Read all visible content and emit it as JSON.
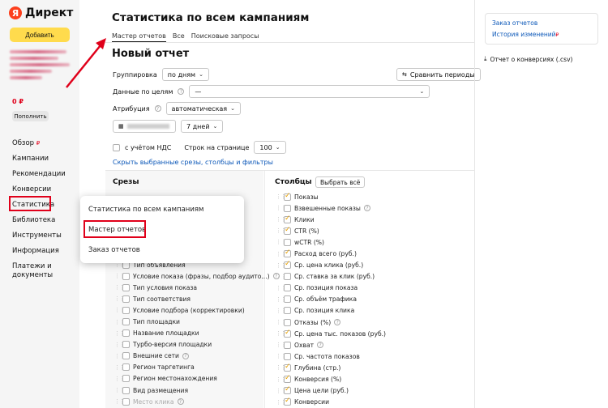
{
  "sidebar": {
    "logo_text": "Директ",
    "logo_mark": "Я",
    "add_label": "Добавить",
    "balance": "0 ₽",
    "refill_label": "Пополнить",
    "items": [
      {
        "label": "Обзор",
        "suffix": "₽"
      },
      {
        "label": "Кампании"
      },
      {
        "label": "Рекомендации"
      },
      {
        "label": "Конверсии"
      },
      {
        "label": "Статистика"
      },
      {
        "label": "Библиотека"
      },
      {
        "label": "Инструменты"
      },
      {
        "label": "Информация"
      },
      {
        "label": "Платежи и документы"
      }
    ]
  },
  "page": {
    "title": "Статистика по всем кампаниям",
    "tabs": [
      "Мастер отчетов",
      "Все",
      "Поисковые запросы"
    ],
    "report_title": "Новый отчет"
  },
  "form": {
    "grouping_label": "Группировка",
    "grouping_value": "по дням",
    "compare_label": "Сравнить периоды",
    "goals_label": "Данные по целям",
    "goals_value": "—",
    "attribution_label": "Атрибуция",
    "attribution_value": "автоматическая",
    "period_value": "7 дней",
    "vat_label": "с учётом НДС",
    "rows_label": "Строк на странице",
    "rows_value": "100",
    "hide_link": "Скрыть выбранные срезы, столбцы и фильтры"
  },
  "slices": {
    "title": "Срезы",
    "items": [
      {
        "label": "Тип объявления",
        "checked": false
      },
      {
        "label": "Условие показа (фразы, подбор аудито...)",
        "checked": false,
        "help": true
      },
      {
        "label": "Тип условия показа",
        "checked": false
      },
      {
        "label": "Тип соответствия",
        "checked": false
      },
      {
        "label": "Условие подбора (корректировки)",
        "checked": false
      },
      {
        "label": "Тип площадки",
        "checked": false
      },
      {
        "label": "Название площадки",
        "checked": false
      },
      {
        "label": "Турбо-версия площадки",
        "checked": false
      },
      {
        "label": "Внешние сети",
        "checked": false,
        "help": true
      },
      {
        "label": "Регион таргетинга",
        "checked": false
      },
      {
        "label": "Регион местонахождения",
        "checked": false
      },
      {
        "label": "Вид размещения",
        "checked": false
      },
      {
        "label": "Место клика",
        "checked": false,
        "help": true,
        "dim": true
      }
    ]
  },
  "columns": {
    "title": "Столбцы",
    "select_all_label": "Выбрать всё",
    "items": [
      {
        "label": "Показы",
        "checked": true
      },
      {
        "label": "Взвешенные показы",
        "checked": false,
        "help": true
      },
      {
        "label": "Клики",
        "checked": true
      },
      {
        "label": "CTR (%)",
        "checked": true
      },
      {
        "label": "wCTR (%)",
        "checked": false
      },
      {
        "label": "Расход всего (руб.)",
        "checked": true
      },
      {
        "label": "Ср. цена клика (руб.)",
        "checked": true
      },
      {
        "label": "Ср. ставка за клик (руб.)",
        "checked": false
      },
      {
        "label": "Ср. позиция показа",
        "checked": false
      },
      {
        "label": "Ср. объём трафика",
        "checked": false
      },
      {
        "label": "Ср. позиция клика",
        "checked": false
      },
      {
        "label": "Отказы (%)",
        "checked": false,
        "help": true
      },
      {
        "label": "Ср. цена тыс. показов (руб.)",
        "checked": true
      },
      {
        "label": "Охват",
        "checked": false,
        "help": true
      },
      {
        "label": "Ср. частота показов",
        "checked": false
      },
      {
        "label": "Глубина (стр.)",
        "checked": true
      },
      {
        "label": "Конверсия (%)",
        "checked": true
      },
      {
        "label": "Цена цели (руб.)",
        "checked": true
      },
      {
        "label": "Конверсии",
        "checked": true
      }
    ]
  },
  "popup": {
    "items": [
      "Статистика по всем кампаниям",
      "Мастер отчетов",
      "Заказ отчетов"
    ]
  },
  "right": {
    "order_link": "Заказ отчетов",
    "history_link": "История изменений",
    "history_suffix": "₽",
    "download_label": "Отчет о конверсиях (.csv)"
  },
  "colors": {
    "accent": "#ffdb4d",
    "highlight": "#e0001a",
    "link": "#0b57b8"
  }
}
